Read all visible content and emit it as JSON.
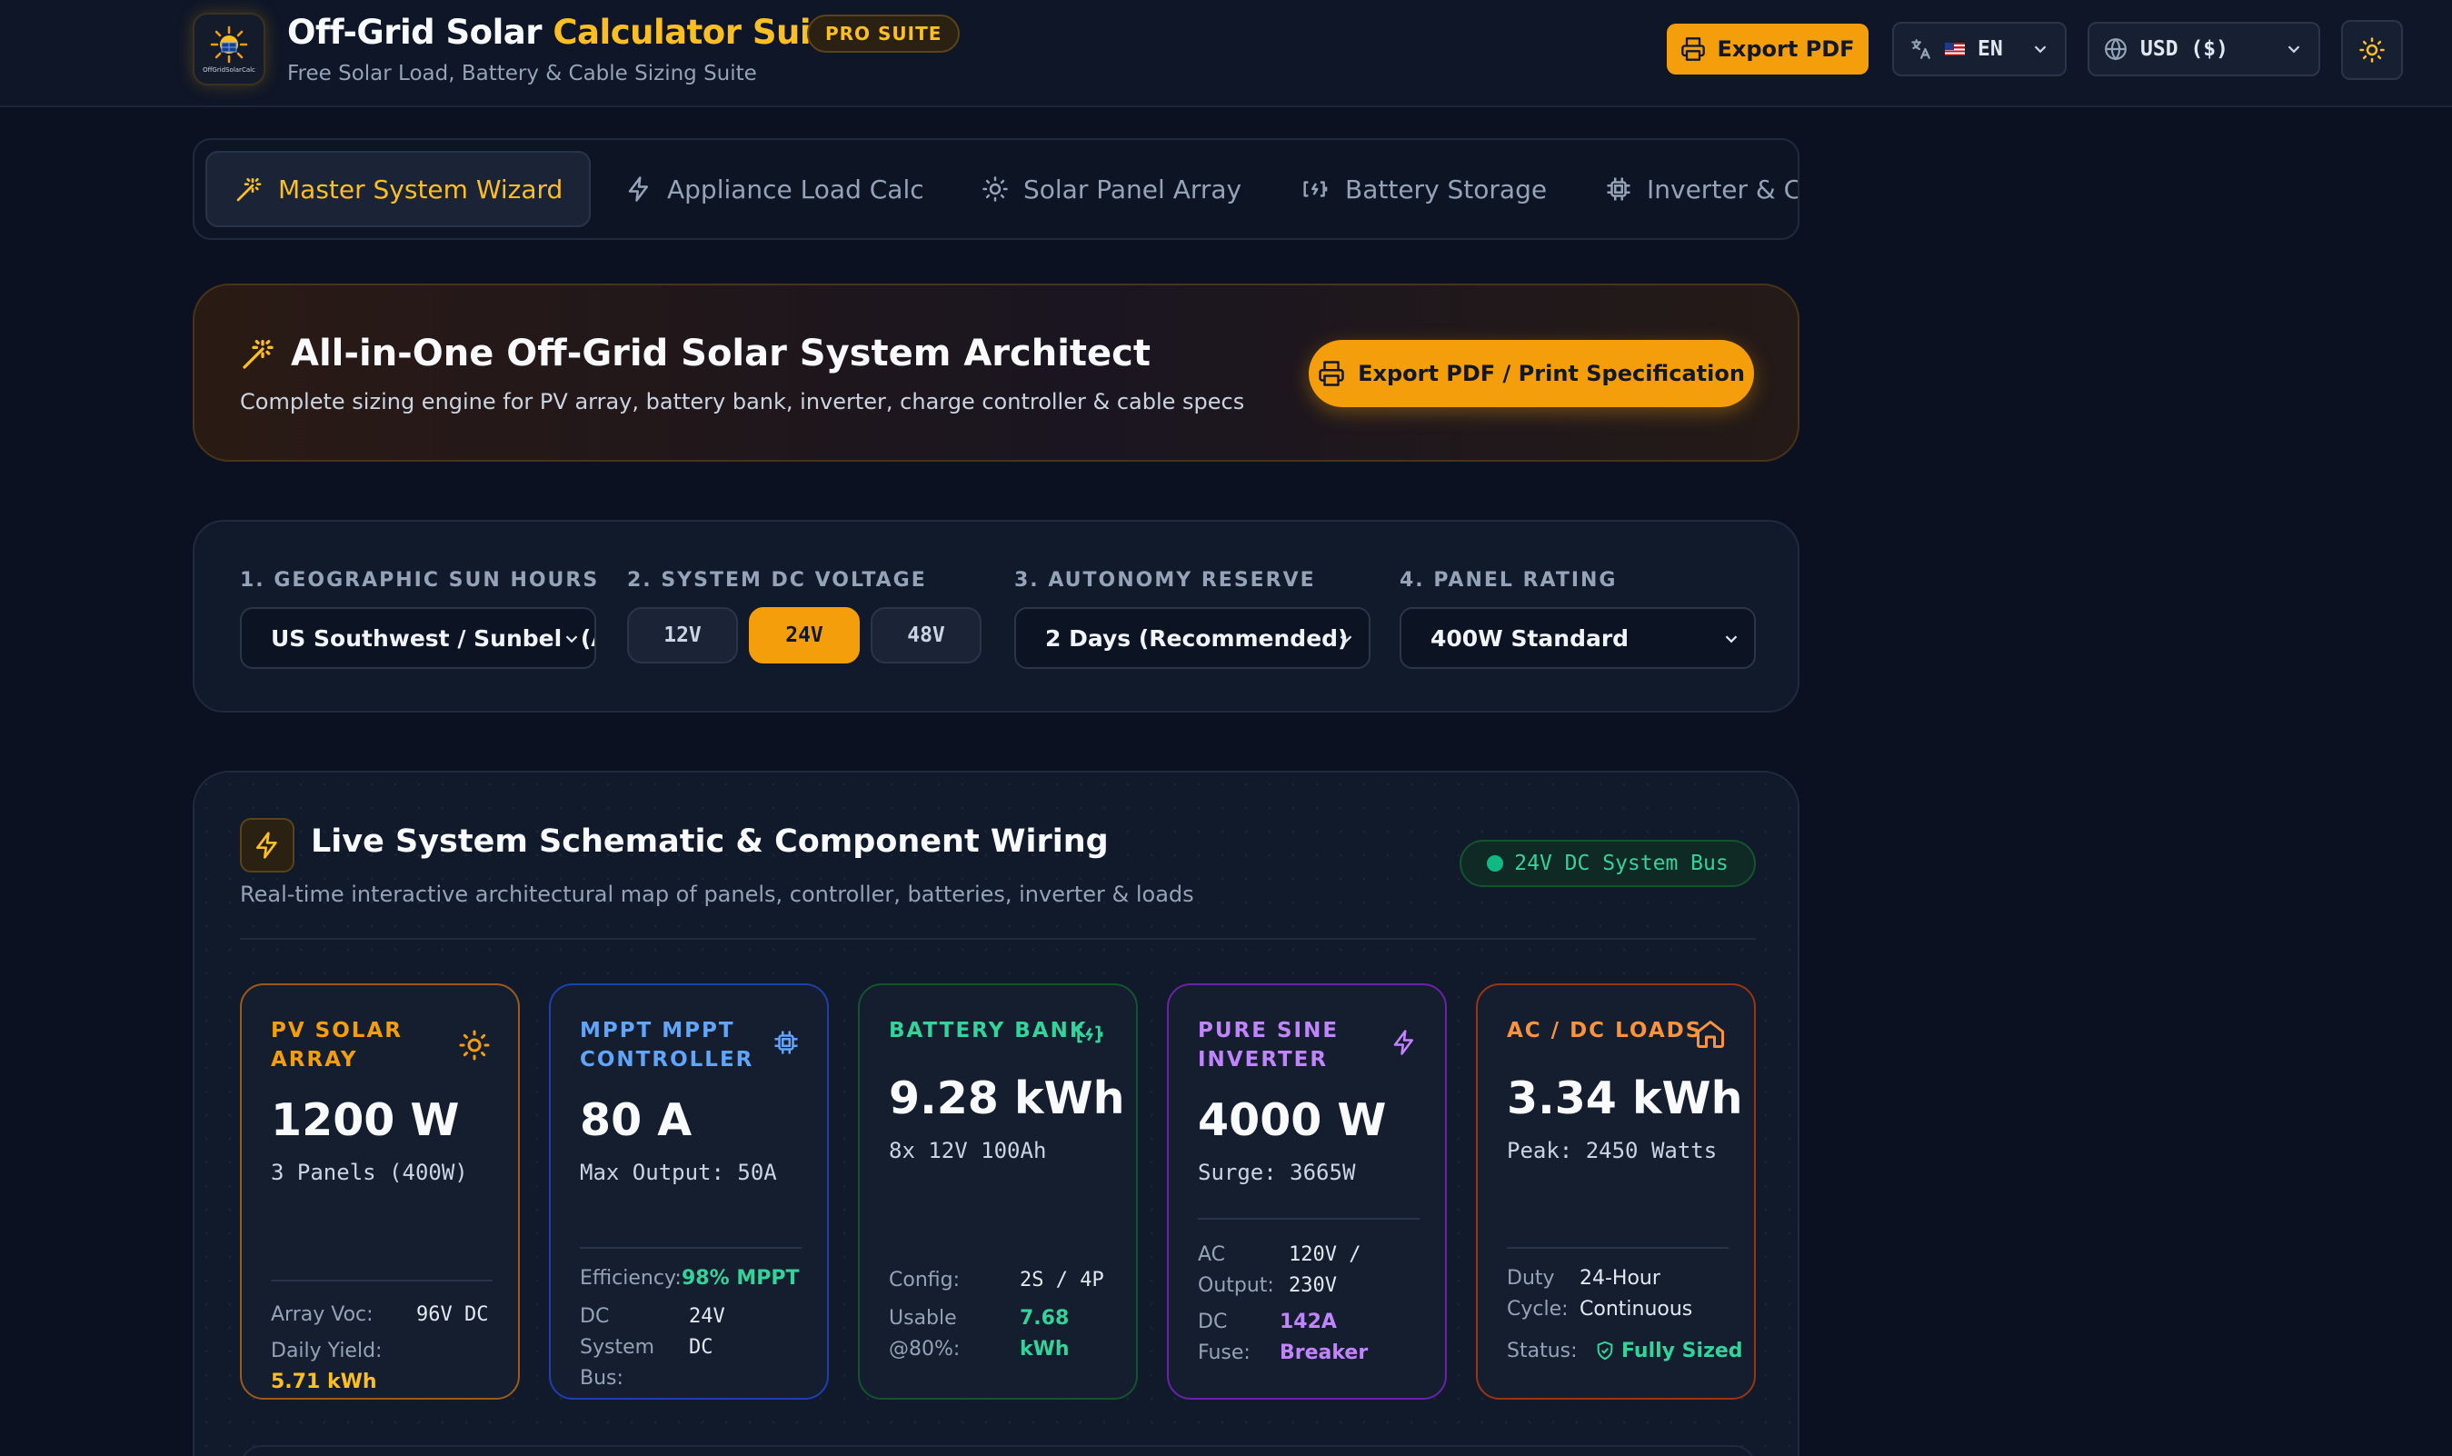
{
  "header": {
    "title_main": "Off-Grid Solar",
    "title_accent": "Calculator Suite",
    "badge": "PRO SUITE",
    "subtitle": "Free Solar Load, Battery & Cable Sizing Suite",
    "export_label": "Export PDF",
    "language": "EN",
    "currency": "USD ($)",
    "logo_text": "OffGridSolarCalc"
  },
  "tabs": [
    {
      "label": "Master System Wizard",
      "icon": "magic-wand-icon"
    },
    {
      "label": "Appliance Load Calc",
      "icon": "bolt-icon"
    },
    {
      "label": "Solar Panel Array",
      "icon": "sun-icon"
    },
    {
      "label": "Battery Storage",
      "icon": "battery-icon"
    },
    {
      "label": "Inverter & C",
      "icon": "chip-icon"
    }
  ],
  "hero": {
    "title": "All-in-One Off-Grid Solar System Architect",
    "subtitle": "Complete sizing engine for PV array, battery bank, inverter, charge controller & cable specs",
    "button": "Export PDF / Print Specification"
  },
  "config": {
    "sun_label": "1. GEOGRAPHIC SUN HOURS",
    "sun_value": "US Southwest / Sunbelt (AZ, NV)",
    "voltage_label": "2. SYSTEM DC VOLTAGE",
    "voltages": [
      "12V",
      "24V",
      "48V"
    ],
    "voltage_selected": "24V",
    "autonomy_label": "3. AUTONOMY RESERVE",
    "autonomy_value": "2 Days (Recommended)",
    "panel_label": "4. PANEL RATING",
    "panel_value": "400W Standard"
  },
  "schematic": {
    "title": "Live System Schematic & Component Wiring",
    "subtitle": "Real-time interactive architectural map of panels, controller, batteries, inverter & loads",
    "bus_badge": "24V DC System Bus",
    "cards": {
      "pv": {
        "head": "PV SOLAR ARRAY",
        "value": "1200 W",
        "sub": "3 Panels (400W)",
        "k1": "Array Voc:",
        "v1": "96V DC",
        "k2": "Daily Yield:",
        "v2": "5.71 kWh"
      },
      "mppt": {
        "head": "MPPT MPPT CONTROLLER",
        "value": "80 A",
        "sub": "Max Output: 50A",
        "k1": "Efficiency:",
        "v1": "98% MPPT",
        "k2": "DC System Bus:",
        "v2": "24V DC"
      },
      "battery": {
        "head": "BATTERY BANK",
        "value": "9.28 kWh",
        "sub": "8x 12V 100Ah",
        "k1": "Config:",
        "v1": "2S / 4P",
        "k2": "Usable @80%:",
        "v2": "7.68 kWh"
      },
      "inverter": {
        "head": "PURE SINE INVERTER",
        "value": "4000 W",
        "sub": "Surge: 3665W",
        "k1": "AC Output:",
        "v1": "120V / 230V",
        "k2": "DC Fuse:",
        "v2": "142A Breaker"
      },
      "loads": {
        "head": "AC / DC LOADS",
        "value": "3.34 kWh",
        "sub": "Peak: 2450 Watts",
        "k1": "Duty Cycle:",
        "v1": "24-Hour Continuous",
        "k2": "Status:",
        "v2": "Fully Sized"
      }
    }
  },
  "colors": {
    "accent": "#f59e0b",
    "pv": "#f59e0b",
    "mppt": "#60a5fa",
    "battery": "#34d399",
    "inverter": "#c084fc",
    "loads": "#fb923c",
    "background": "#0b1120"
  }
}
